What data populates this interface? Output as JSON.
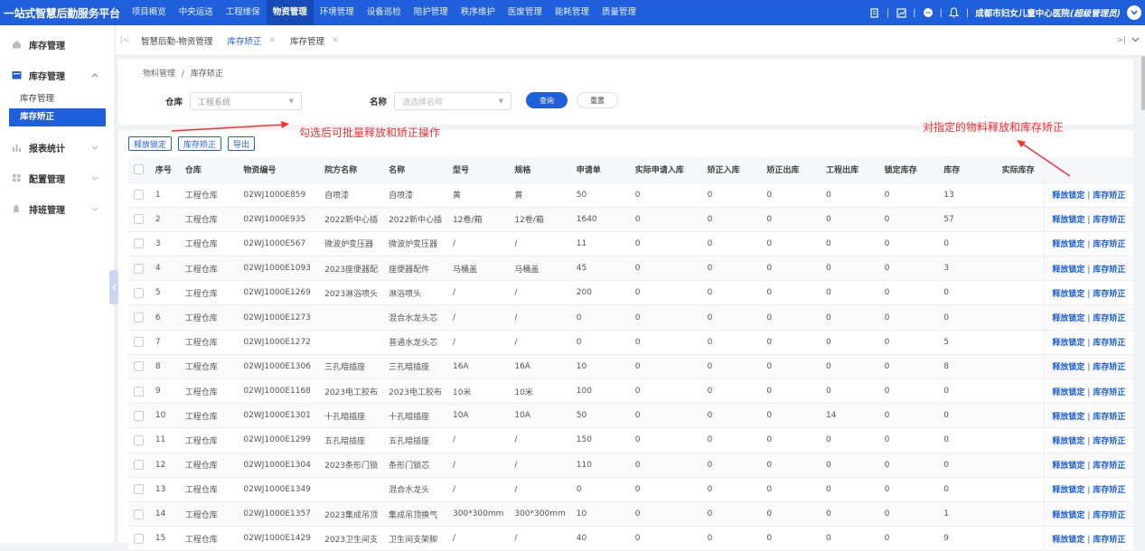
{
  "app": {
    "title": "一站式智慧后勤服务平台",
    "nav": [
      "项目概览",
      "中央运送",
      "工程维保",
      "物资管理",
      "环境管理",
      "设备巡检",
      "陪护管理",
      "秩序维护",
      "医废管理",
      "能耗管理",
      "质量管理"
    ],
    "nav_active": 3,
    "user": "成都市妇女儿童中心医院",
    "role": "(超级管理员)",
    "separator": "|"
  },
  "sidebar": {
    "groups": [
      {
        "label": "库存管理",
        "icon": "home-icon",
        "open": false
      },
      {
        "label": "库存管理",
        "icon": "folder-icon",
        "open": true,
        "children": [
          "库存管理",
          "库存矫正"
        ],
        "active_child": 1
      },
      {
        "label": "报表统计",
        "icon": "bar-chart-icon",
        "open": false
      },
      {
        "label": "配置管理",
        "icon": "grid-icon",
        "open": false
      },
      {
        "label": "排班管理",
        "icon": "bell-icon",
        "open": false
      }
    ]
  },
  "tabs": {
    "items": [
      {
        "label": "智慧后勤-物资管理",
        "closable": false,
        "active": false
      },
      {
        "label": "库存矫正",
        "closable": true,
        "active": true
      },
      {
        "label": "库存管理",
        "closable": true,
        "active": false
      }
    ]
  },
  "breadcrumb": {
    "parent": "物料管理",
    "sep": "/",
    "current": "库存矫正"
  },
  "filters": {
    "warehouse_label": "仓库",
    "warehouse_value": "工程系统",
    "name_label": "名称",
    "name_placeholder": "请选择名称",
    "query_label": "查询",
    "reset_label": "重置"
  },
  "toolbar": {
    "release": "释放锁定",
    "correct": "库存矫正",
    "export": "导出"
  },
  "annotations": {
    "left": "勾选后可批量释放和矫正操作",
    "right": "对指定的物料释放和库存矫正"
  },
  "table": {
    "headers": [
      "序号",
      "仓库",
      "物资编号",
      "院方名称",
      "名称",
      "型号",
      "规格",
      "申请单",
      "实际申请入库",
      "矫正入库",
      "矫正出库",
      "工程出库",
      "锁定库存",
      "库存",
      "实际库存"
    ],
    "op_release": "释放锁定",
    "op_correct": "库存矫正",
    "op_sep": "|",
    "rows": [
      [
        "1",
        "工程仓库",
        "02WJ1000E859",
        "自喷漆",
        "自喷漆",
        "黄",
        "黄",
        "50",
        "0",
        "0",
        "0",
        "0",
        "0",
        "13",
        ""
      ],
      [
        "2",
        "工程仓库",
        "02WJ1000E935",
        "2022新中心插",
        "2022新中心插",
        "12卷/箱",
        "12卷/箱",
        "1640",
        "0",
        "0",
        "0",
        "0",
        "0",
        "57",
        ""
      ],
      [
        "3",
        "工程仓库",
        "02WJ1000E567",
        "微波炉变压器",
        "微波炉变压器",
        "/",
        "/",
        "11",
        "0",
        "0",
        "0",
        "0",
        "0",
        "0",
        ""
      ],
      [
        "4",
        "工程仓库",
        "02WJ1000E1093",
        "2023座便器配",
        "座便器配件",
        "马桶盖",
        "马桶盖",
        "45",
        "0",
        "0",
        "0",
        "0",
        "0",
        "3",
        ""
      ],
      [
        "5",
        "工程仓库",
        "02WJ1000E1269",
        "2023淋浴喷头",
        "淋浴喷头",
        "/",
        "/",
        "200",
        "0",
        "0",
        "0",
        "0",
        "0",
        "0",
        ""
      ],
      [
        "6",
        "工程仓库",
        "02WJ1000E1273",
        "",
        "混合水龙头芯",
        "/",
        "/",
        "0",
        "0",
        "0",
        "0",
        "0",
        "0",
        "0",
        ""
      ],
      [
        "7",
        "工程仓库",
        "02WJ1000E1272",
        "",
        "普通水龙头芯",
        "/",
        "/",
        "0",
        "0",
        "0",
        "0",
        "0",
        "0",
        "5",
        ""
      ],
      [
        "8",
        "工程仓库",
        "02WJ1000E1306",
        "三孔暗插座",
        "三孔暗插座",
        "16A",
        "16A",
        "10",
        "0",
        "0",
        "0",
        "0",
        "0",
        "8",
        ""
      ],
      [
        "9",
        "工程仓库",
        "02WJ1000E1168",
        "2023电工胶布",
        "2023电工胶布",
        "10米",
        "10米",
        "100",
        "0",
        "0",
        "0",
        "0",
        "0",
        "0",
        ""
      ],
      [
        "10",
        "工程仓库",
        "02WJ1000E1301",
        "十孔暗插座",
        "十孔暗插座",
        "10A",
        "10A",
        "50",
        "0",
        "0",
        "0",
        "14",
        "0",
        "0",
        ""
      ],
      [
        "11",
        "工程仓库",
        "02WJ1000E1299",
        "五孔暗插座",
        "五孔暗插座",
        "/",
        "/",
        "150",
        "0",
        "0",
        "0",
        "0",
        "0",
        "0",
        ""
      ],
      [
        "12",
        "工程仓库",
        "02WJ1000E1304",
        "2023条形门锁",
        "条形门锁芯",
        "/",
        "/",
        "110",
        "0",
        "0",
        "0",
        "0",
        "0",
        "0",
        ""
      ],
      [
        "13",
        "工程仓库",
        "02WJ1000E1349",
        "",
        "混合水龙头",
        "/",
        "/",
        "0",
        "0",
        "0",
        "0",
        "0",
        "0",
        "0",
        ""
      ],
      [
        "14",
        "工程仓库",
        "02WJ1000E1357",
        "2023集成吊顶",
        "集成吊顶换气",
        "300*300mm",
        "300*300mm",
        "10",
        "0",
        "0",
        "0",
        "0",
        "0",
        "1",
        ""
      ],
      [
        "15",
        "工程仓库",
        "02WJ1000E1429",
        "2023卫生间支",
        "卫生间支架脚",
        "/",
        "/",
        "40",
        "0",
        "0",
        "0",
        "0",
        "0",
        "9",
        ""
      ]
    ]
  },
  "colors": {
    "primary": "#1f5fdc",
    "annotation": "#ff2d2d"
  }
}
